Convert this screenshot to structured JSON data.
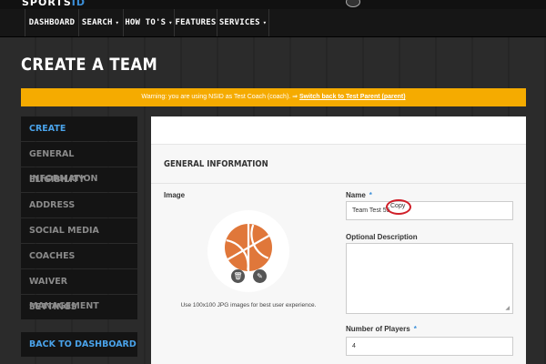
{
  "header": {
    "logo_main": "SPORTS",
    "logo_accent": "ID"
  },
  "nav": {
    "items": [
      {
        "label": "DASHBOARD",
        "dropdown": false
      },
      {
        "label": "SEARCH",
        "dropdown": true
      },
      {
        "label": "HOW TO'S",
        "dropdown": true
      },
      {
        "label": "FEATURES",
        "dropdown": false
      },
      {
        "label": "SERVICES",
        "dropdown": true
      }
    ]
  },
  "page": {
    "title": "CREATE A TEAM"
  },
  "warning": {
    "text": "Warning: you are using NSID as Test Coach (coach).",
    "link_arrow": "⇒",
    "link": "Switch back to Test Parent (parent)"
  },
  "sidebar": {
    "items": [
      {
        "label": "CREATE",
        "active": true
      },
      {
        "label": "GENERAL INFORMATION",
        "active": false
      },
      {
        "label": "ELIGIBILITY",
        "active": false
      },
      {
        "label": "ADDRESS",
        "active": false
      },
      {
        "label": "SOCIAL MEDIA",
        "active": false
      },
      {
        "label": "COACHES",
        "active": false
      },
      {
        "label": "WAIVER MANAGEMENT",
        "active": false
      },
      {
        "label": "SETTINGS",
        "active": false
      }
    ],
    "back_label": "BACK TO DASHBOARD"
  },
  "form": {
    "section_title": "GENERAL INFORMATION",
    "image_label": "Image",
    "image_hint": "Use 100x100 JPG images for best user experience.",
    "name_label": "Name",
    "name_required": "*",
    "name_value": "Team Test 55",
    "name_highlight": "Copy",
    "description_label": "Optional Description",
    "description_value": "",
    "players_label": "Number of Players",
    "players_required": "*",
    "players_value": "4"
  },
  "colors": {
    "accent_blue": "#4aa3ea",
    "warning_bg": "#f5ab00",
    "highlight_red": "#d0202a"
  },
  "icons": {
    "caret": "▾",
    "trash": "🗑",
    "pencil": "✎"
  }
}
